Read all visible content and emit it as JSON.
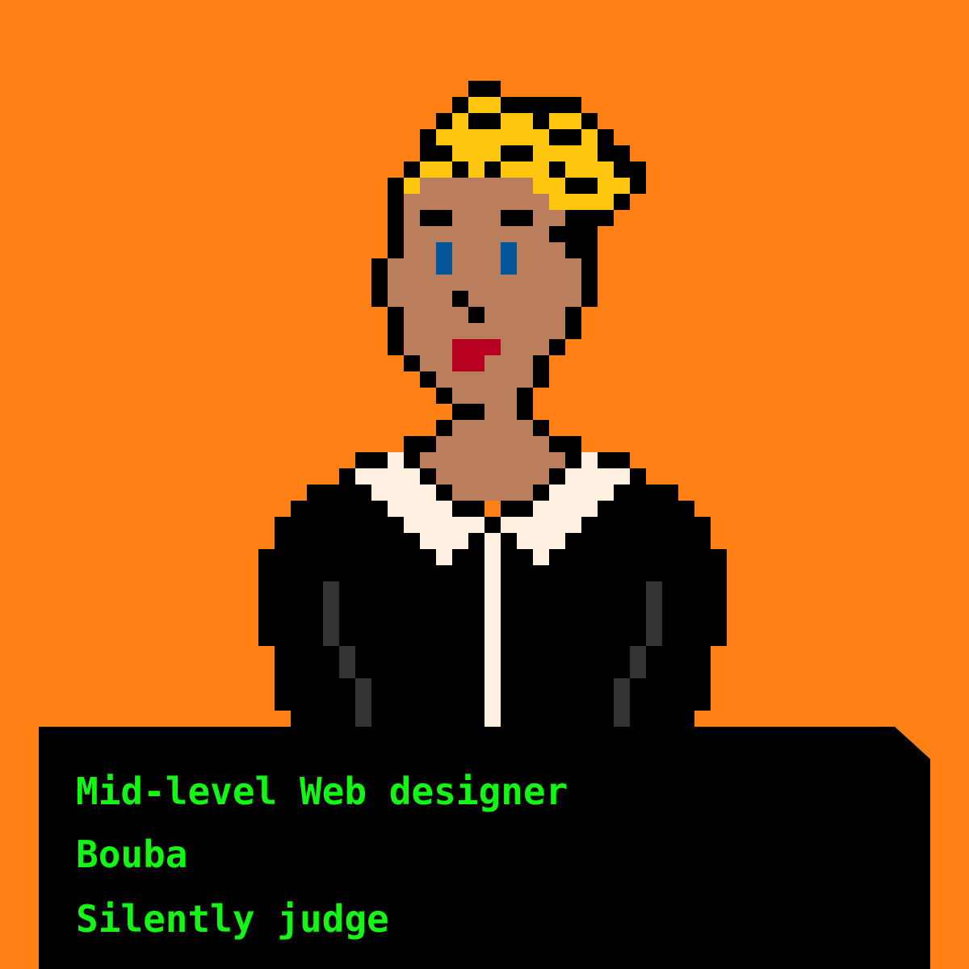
{
  "colors": {
    "background": "#FF8015",
    "outline": "#000000",
    "hair": "#FFC60F",
    "skin": "#BA7E5D",
    "eyes": "#05559C",
    "lips": "#B8001F",
    "collar": "#FDF0E0",
    "jacket_shade": "#333333",
    "panel": "#000000",
    "text": "#14F714"
  },
  "avatar": {
    "description_icon": "pixel-art-portrait-icon"
  },
  "info": {
    "role": "Mid-level Web designer",
    "name": "Bouba",
    "trait": "Silently judge"
  }
}
